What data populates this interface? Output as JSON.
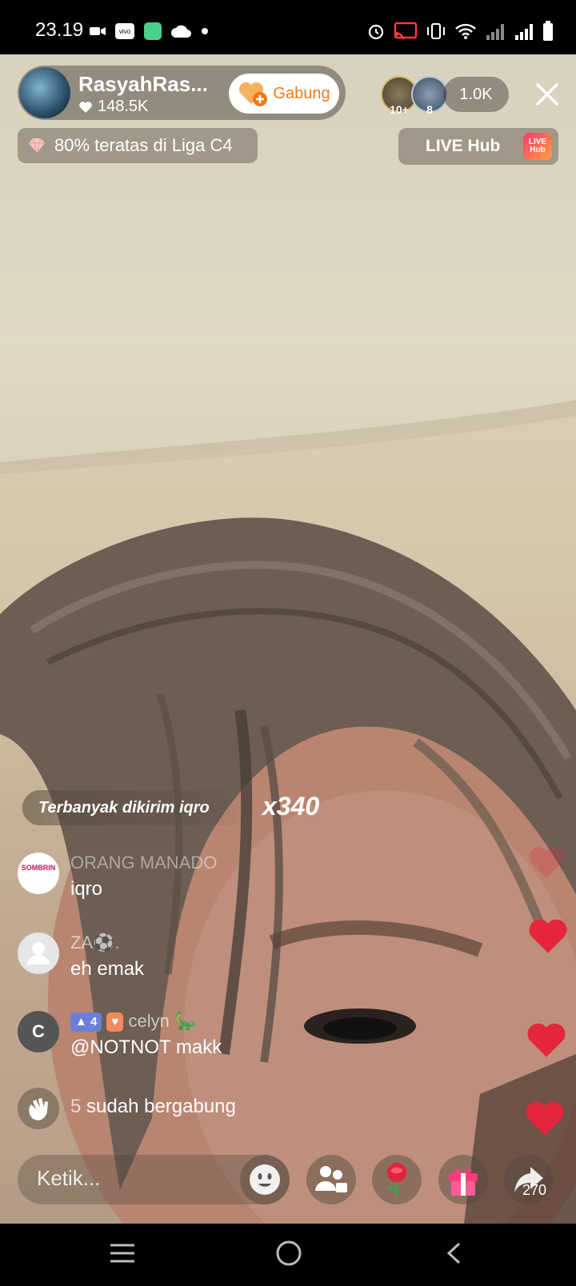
{
  "status_bar": {
    "time": "23.19",
    "icons": [
      "video-camera-icon",
      "vivo-icon",
      "app-icon",
      "cloud-icon",
      "dot-icon",
      "alarm-icon",
      "cast-icon",
      "vibrate-icon",
      "wifi-icon",
      "signal-1-icon",
      "signal-2-icon",
      "battery-icon"
    ],
    "vivo_label": "vivo"
  },
  "host": {
    "name": "RasyahRas...",
    "likes": "148.5K",
    "join_label": "Gabung"
  },
  "viewers": {
    "avatar_1_badge": "10+",
    "avatar_2_badge": "8",
    "count": "1.0K"
  },
  "league": {
    "text": "80% teratas di Liga C4"
  },
  "live_hub": {
    "label": "LIVE Hub",
    "logo_text_1": "LIVE",
    "logo_text_2": "Hub"
  },
  "gift_banner": {
    "text": "Terbanyak dikirim iqro",
    "count": "x340"
  },
  "comments": [
    {
      "name": "ORANG MANADO",
      "text": "iqro",
      "avatar_text": "SOMBRIN"
    },
    {
      "name": "ZA⚽.",
      "text": "eh emak"
    },
    {
      "name": "celyn 🦕",
      "text": "@NOTNOT makk",
      "avatar_letter": "C",
      "level": "4"
    },
    {
      "text_count": "5",
      "text": "sudah bergabung"
    }
  ],
  "bottom_bar": {
    "input_placeholder": "Ketik...",
    "share_count": "270"
  },
  "colors": {
    "accent_orange": "#ef7a1a",
    "heart_red": "#e3263b",
    "gift_pink": "#ff3b7f"
  }
}
